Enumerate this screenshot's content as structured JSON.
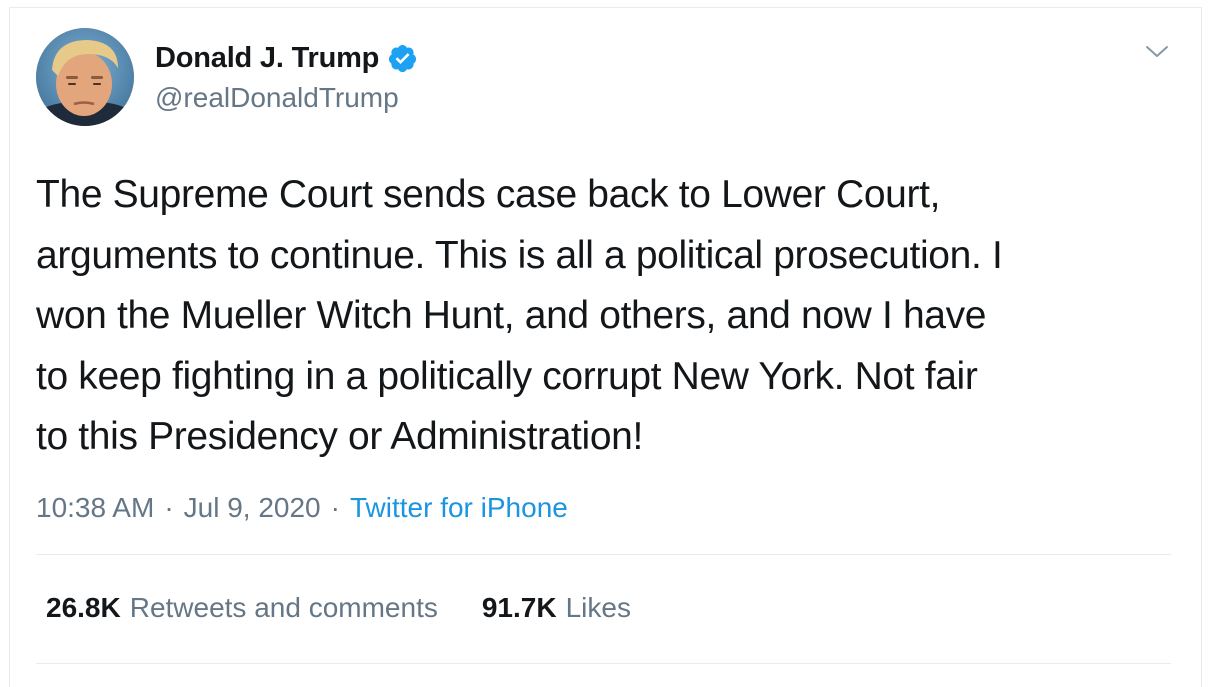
{
  "author": {
    "display_name": "Donald J. Trump",
    "handle": "@realDonaldTrump",
    "verified": true,
    "avatar_icon": "user-avatar"
  },
  "tweet": {
    "text": "The Supreme Court sends case back to Lower Court,\narguments to continue. This is all a political prosecution. I\nwon the Mueller Witch Hunt, and others, and now I have\nto keep fighting in a politically corrupt New York. Not fair\nto this Presidency or Administration!",
    "time": "10:38 AM",
    "separator": "·",
    "date": "Jul 9, 2020",
    "source": "Twitter for iPhone"
  },
  "stats": {
    "retweets_count": "26.8K",
    "retweets_label": "Retweets and comments",
    "likes_count": "91.7K",
    "likes_label": "Likes"
  },
  "colors": {
    "accent": "#1b95e0",
    "text_primary": "#14171a",
    "text_secondary": "#657786",
    "divider": "#e6ecf0"
  },
  "icons": {
    "verified": "verified-badge-icon",
    "menu": "chevron-down-icon"
  }
}
